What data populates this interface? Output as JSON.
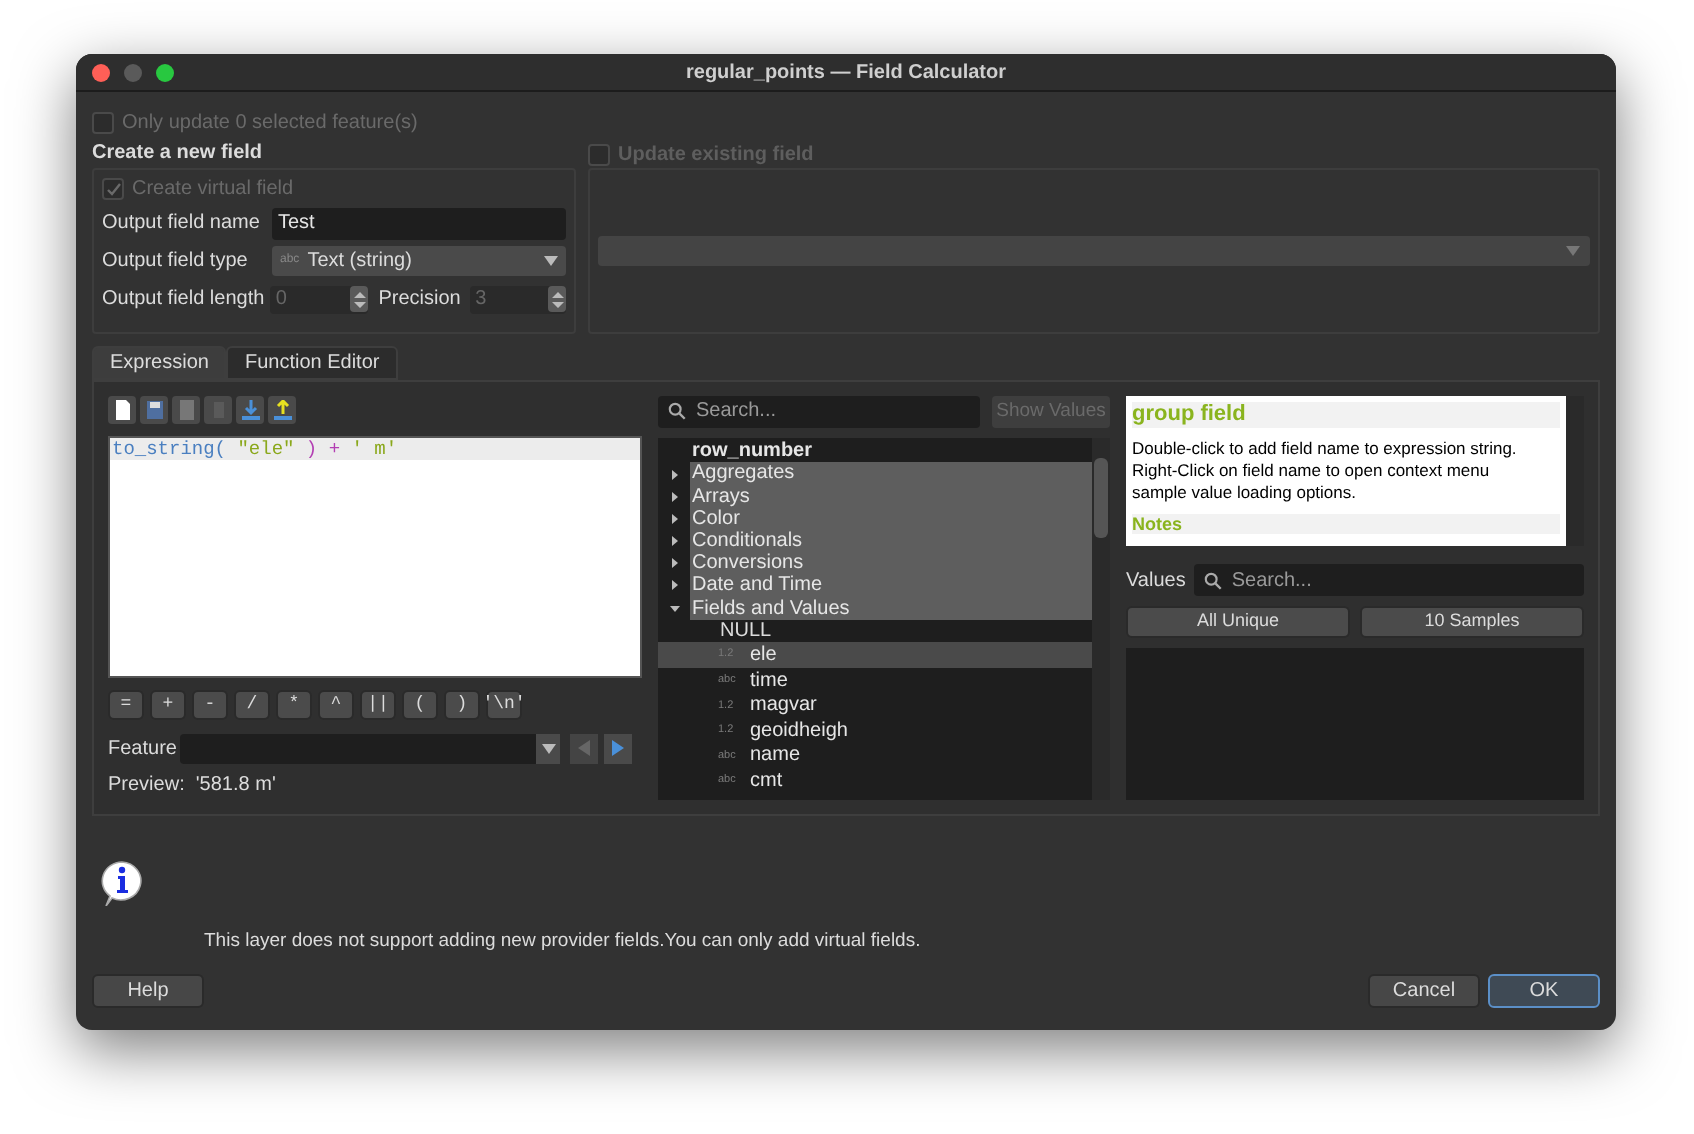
{
  "window": {
    "title": "regular_points — Field Calculator"
  },
  "only_update": {
    "label": "Only update 0 selected feature(s)",
    "checked": false,
    "disabled": true
  },
  "create_group": {
    "title": "Create a new field",
    "virtual": {
      "label": "Create virtual field",
      "checked": true,
      "disabled": true
    },
    "name": {
      "label": "Output field name",
      "value": "Test"
    },
    "type": {
      "label": "Output field type",
      "badge": "abc",
      "value": "Text (string)"
    },
    "length": {
      "label": "Output field length",
      "value": "0"
    },
    "precision": {
      "label": "Precision",
      "value": "3"
    }
  },
  "update_group": {
    "label": "Update existing field",
    "checked": false,
    "disabled": true
  },
  "tabs": [
    {
      "label": "Expression",
      "selected": true
    },
    {
      "label": "Function Editor",
      "selected": false
    }
  ],
  "expression": {
    "tokens": [
      {
        "kind": "function",
        "text": "to_string("
      },
      {
        "kind": "field",
        "text": " \"ele\""
      },
      {
        "kind": "operator",
        "text": " ) +"
      },
      {
        "kind": "string",
        "text": " ' m'"
      }
    ]
  },
  "operators": [
    "=",
    "+",
    "-",
    "/",
    "*",
    "^",
    "||",
    "(",
    ")",
    "'\\n'"
  ],
  "feature": {
    "label": "Feature"
  },
  "preview": "Preview:  '581.8 m'",
  "function_search": {
    "placeholder": "Search..."
  },
  "show_values": {
    "label": "Show Values",
    "disabled": true
  },
  "tree": [
    {
      "kind": "item",
      "label": "row_number",
      "selected": false
    },
    {
      "kind": "group",
      "label": "Aggregates",
      "expanded": false
    },
    {
      "kind": "group",
      "label": "Arrays",
      "expanded": false
    },
    {
      "kind": "group",
      "label": "Color",
      "expanded": false
    },
    {
      "kind": "group",
      "label": "Conditionals",
      "expanded": false
    },
    {
      "kind": "group",
      "label": "Conversions",
      "expanded": false
    },
    {
      "kind": "group",
      "label": "Date and Time",
      "expanded": false
    },
    {
      "kind": "group",
      "label": "Fields and Values",
      "expanded": true,
      "children": [
        {
          "kind": "item",
          "label": "NULL",
          "selected": false
        },
        {
          "kind": "field",
          "type": "1.2",
          "label": "ele",
          "selected": true
        },
        {
          "kind": "field",
          "type": "abc",
          "label": "time",
          "selected": false
        },
        {
          "kind": "field",
          "type": "1.2",
          "label": "magvar",
          "selected": false
        },
        {
          "kind": "field",
          "type": "1.2",
          "label": "geoidheigh",
          "selected": false
        },
        {
          "kind": "field",
          "type": "abc",
          "label": "name",
          "selected": false
        },
        {
          "kind": "field",
          "type": "abc",
          "label": "cmt",
          "selected": false
        }
      ]
    }
  ],
  "help": {
    "title": "group field",
    "body": "Double-click to add field name to expression string. Right-Click on field name to open context menu sample value loading options.",
    "notes": "Notes"
  },
  "values": {
    "label": "Values",
    "placeholder": "Search...",
    "buttons": [
      "All Unique",
      "10 Samples"
    ]
  },
  "message": "This layer does not support adding new provider fields.You can only add virtual fields.",
  "buttons": [
    {
      "label": "Help",
      "default": false
    },
    {
      "label": "Cancel",
      "default": false
    },
    {
      "label": "OK",
      "default": true
    }
  ]
}
